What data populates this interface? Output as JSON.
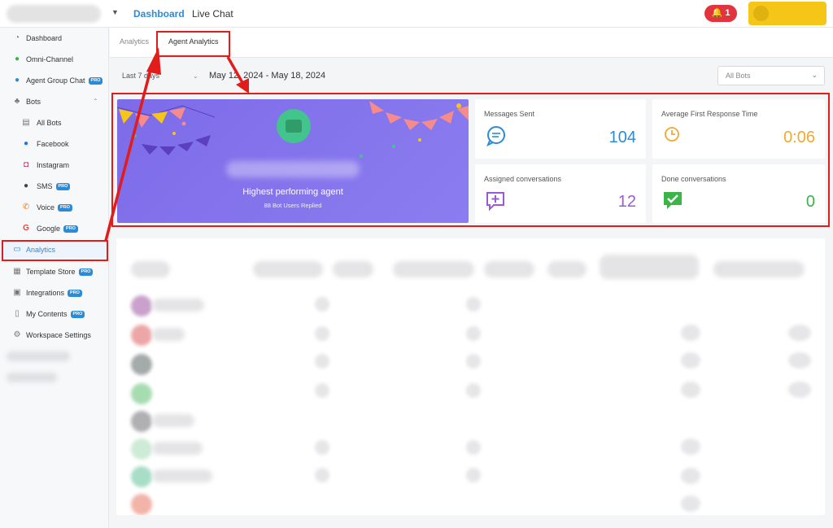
{
  "topbar": {
    "nav": {
      "dashboard": "Dashboard",
      "live_chat": "Live Chat"
    },
    "notification_count": "1"
  },
  "sidebar": {
    "items": [
      {
        "label": "Dashboard",
        "icon": "dashboard-icon"
      },
      {
        "label": "Omni-Channel",
        "icon": "chat-bubbles-icon"
      },
      {
        "label": "Agent Group Chat",
        "icon": "agent-headset-icon",
        "badge": "PRO"
      },
      {
        "label": "Bots",
        "icon": "sitemap-icon"
      },
      {
        "label": "All Bots",
        "icon": "document-icon"
      },
      {
        "label": "Facebook",
        "icon": "messenger-icon"
      },
      {
        "label": "Instagram",
        "icon": "instagram-icon"
      },
      {
        "label": "SMS",
        "icon": "sms-icon",
        "badge": "PRO"
      },
      {
        "label": "Voice",
        "icon": "phone-icon",
        "badge": "PRO"
      },
      {
        "label": "Google",
        "icon": "google-icon",
        "badge": "PRO"
      },
      {
        "label": "Analytics",
        "icon": "analytics-icon"
      },
      {
        "label": "Template Store",
        "icon": "store-icon",
        "badge": "PRO"
      },
      {
        "label": "Integrations",
        "icon": "integrations-icon",
        "badge": "PRO"
      },
      {
        "label": "My Contents",
        "icon": "file-icon",
        "badge": "PRO"
      },
      {
        "label": "Workspace Settings",
        "icon": "gear-icon"
      }
    ]
  },
  "tabs": {
    "analytics": "Analytics",
    "agent_analytics": "Agent Analytics"
  },
  "filters": {
    "period": "Last 7 days",
    "date_range": "May 12, 2024 - May 18, 2024",
    "bots_select": "All Bots"
  },
  "hero": {
    "title": "Highest performing agent",
    "subtitle": "88 Bot Users Replied"
  },
  "stats": {
    "messages_sent": {
      "label": "Messages Sent",
      "value": "104",
      "color": "#2a8bd8"
    },
    "avg_first_response": {
      "label": "Average First Response Time",
      "value": "0:06",
      "color": "#f0a92e"
    },
    "assigned": {
      "label": "Assigned conversations",
      "value": "12",
      "color": "#9b59d8"
    },
    "done": {
      "label": "Done conversations",
      "value": "0",
      "color": "#3bb44a"
    }
  },
  "colors": {
    "accent": "#2a8bd8",
    "highlight": "#e21b1b",
    "hero_bg": "#7d6be8"
  }
}
